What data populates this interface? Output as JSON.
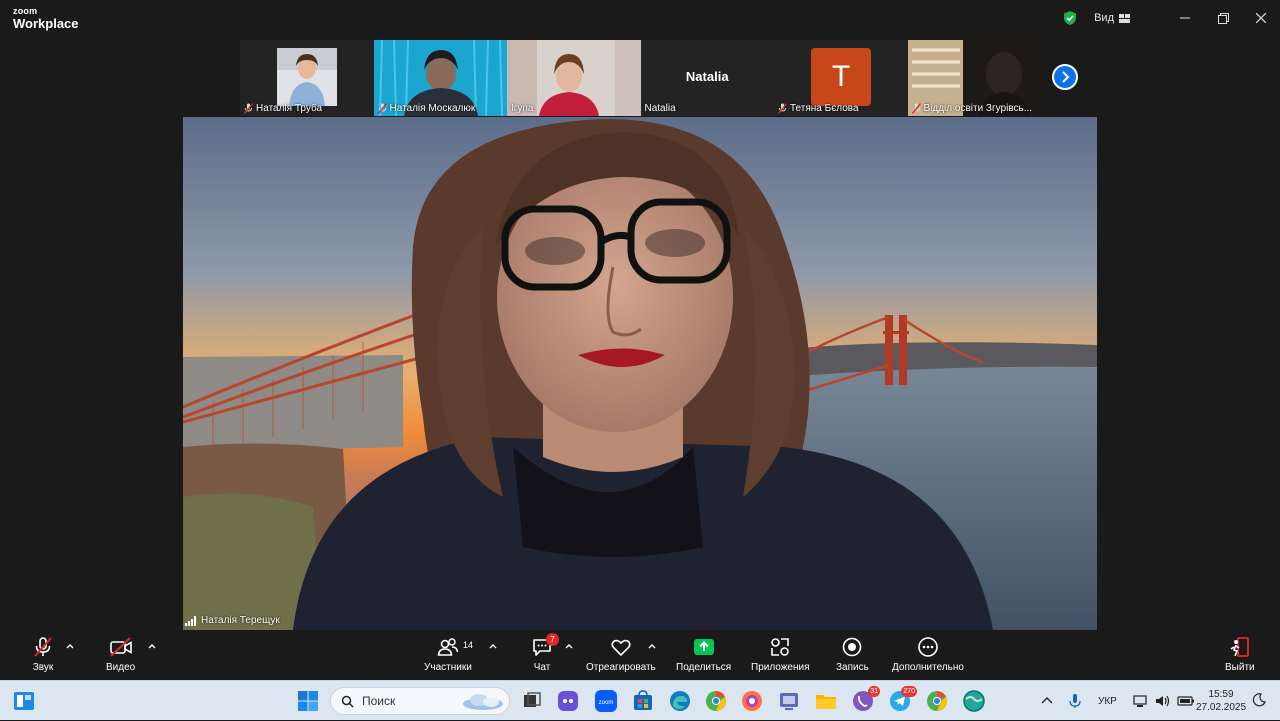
{
  "app": {
    "brand_top": "zoom",
    "brand_bottom": "Workplace"
  },
  "titlebar": {
    "view_label": "Вид"
  },
  "thumbnails": [
    {
      "name": "Наталія Труба",
      "muted": true
    },
    {
      "name": "Наталія Москалюк",
      "muted": true
    },
    {
      "name": "Ігупа",
      "muted": false
    },
    {
      "name": "Natalia",
      "muted": false,
      "center_name": "Natalia"
    },
    {
      "name": "Тетяна Бєлова",
      "muted": true,
      "avatar_letter": "T"
    },
    {
      "name": "Відділ освіти Згурівсь...",
      "muted": true
    }
  ],
  "main_speaker": {
    "name": "Наталія Терещук"
  },
  "toolbar": {
    "audio": "Звук",
    "video": "Видео",
    "participants": "Участники",
    "participants_count": "14",
    "chat": "Чат",
    "chat_badge": "7",
    "react": "Отреагировать",
    "share": "Поделиться",
    "apps": "Приложения",
    "record": "Запись",
    "more": "Дополнительно",
    "leave": "Выйти"
  },
  "taskbar": {
    "search_placeholder": "Поиск",
    "lang": "УКР",
    "time": "15:59",
    "date": "27.02.2025",
    "viber_badge": "31",
    "telegram_badge": "270"
  },
  "colors": {
    "accent": "#0e72ed",
    "share_green": "#00c853",
    "muted_red": "#e02828",
    "avatar_orange": "#c8471a"
  }
}
